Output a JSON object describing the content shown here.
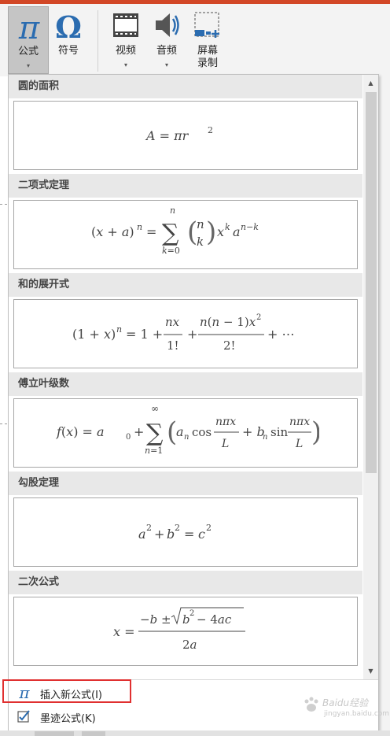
{
  "ribbon": {
    "equation_label": "公式",
    "symbol_label": "符号",
    "video_label": "视频",
    "audio_label": "音频",
    "screen_record_label": "屏幕\n录制",
    "dropdown_caret": "▾"
  },
  "gallery": {
    "categories": [
      {
        "label": "圆的面积",
        "formula": "A = πr²"
      },
      {
        "label": "二项式定理",
        "formula": "(x + a)ⁿ = Σ_{k=0}^{n} (n k) xᵏ aⁿ⁻ᵏ"
      },
      {
        "label": "和的展开式",
        "formula": "(1 + x)ⁿ = 1 + nx/1! + n(n − 1)x²/2! + ⋯"
      },
      {
        "label": "傅立叶级数",
        "formula": "f(x) = a₀ + Σ_{n=1}^{∞} (aₙ cos nπx/L + bₙ sin nπx/L)"
      },
      {
        "label": "勾股定理",
        "formula": "a² + b² = c²"
      },
      {
        "label": "二次公式",
        "formula": "x = (−b ± √(b² − 4ac)) / 2a"
      }
    ]
  },
  "actions": {
    "insert_new": "插入新公式(I)",
    "ink": "墨迹公式(K)"
  },
  "watermark": {
    "line1": "Baidu经验",
    "line2": "jingyan.baidu.com"
  },
  "colors": {
    "accent_bar": "#d24726",
    "pi_icon": "#2b6cb0",
    "highlight_box": "#e03030"
  }
}
